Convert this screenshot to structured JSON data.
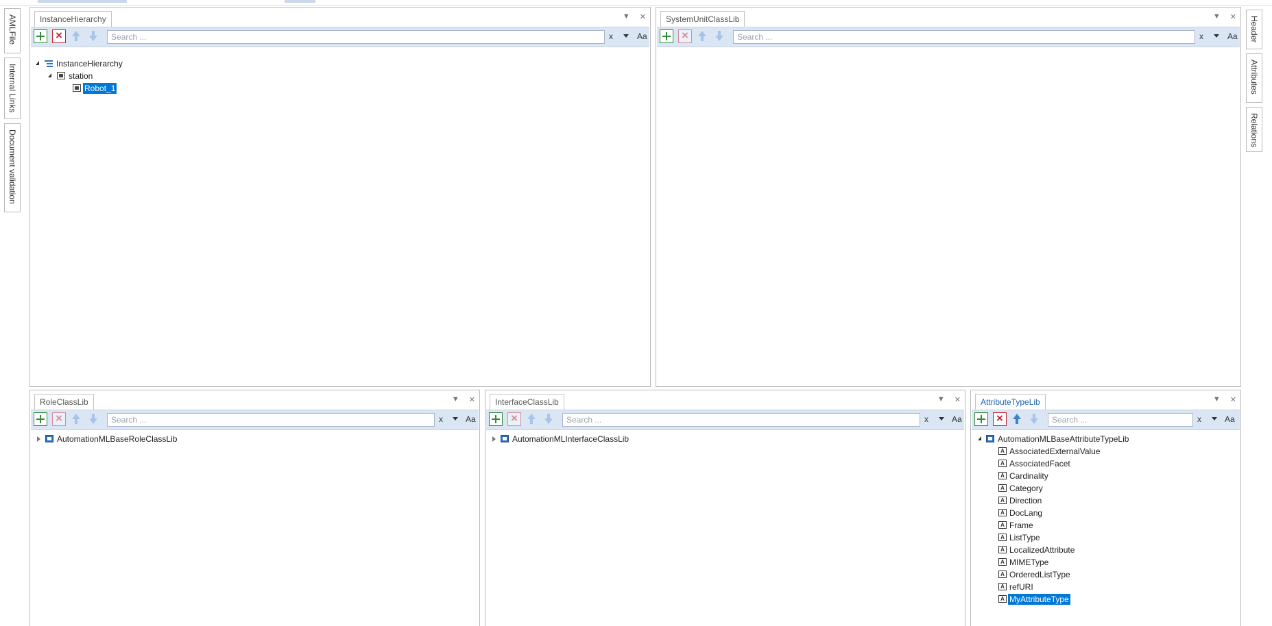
{
  "left_tabs": [
    "AMLFile",
    "Internal Links",
    "Document validation"
  ],
  "right_tabs": [
    "Header",
    "Attributes",
    "Relations"
  ],
  "search_placeholder": "Search ...",
  "clear_label": "x",
  "case_label": "Aa",
  "panels": {
    "instance_hierarchy": {
      "tab": "InstanceHierarchy",
      "tree": [
        "InstanceHierarchy",
        "station",
        "Robot_1"
      ]
    },
    "system_unit_class_lib": {
      "tab": "SystemUnitClassLib",
      "tree": []
    },
    "role_class_lib": {
      "tab": "RoleClassLib",
      "tree": [
        "AutomationMLBaseRoleClassLib"
      ]
    },
    "interface_class_lib": {
      "tab": "InterfaceClassLib",
      "tree": [
        "AutomationMLInterfaceClassLib"
      ]
    },
    "attribute_type_lib": {
      "tab": "AttributeTypeLib",
      "root": "AutomationMLBaseAttributeTypeLib",
      "items": [
        "AssociatedExternalValue",
        "AssociatedFacet",
        "Cardinality",
        "Category",
        "Direction",
        "DocLang",
        "Frame",
        "ListType",
        "LocalizedAttribute",
        "MIMEType",
        "OrderedListType",
        "refURI",
        "MyAttributeType"
      ],
      "selected": "MyAttributeType"
    }
  },
  "colors": {
    "selection": "#0078d7",
    "toolbar": "#dbe6f4",
    "active_tab": "#1c64b4"
  }
}
